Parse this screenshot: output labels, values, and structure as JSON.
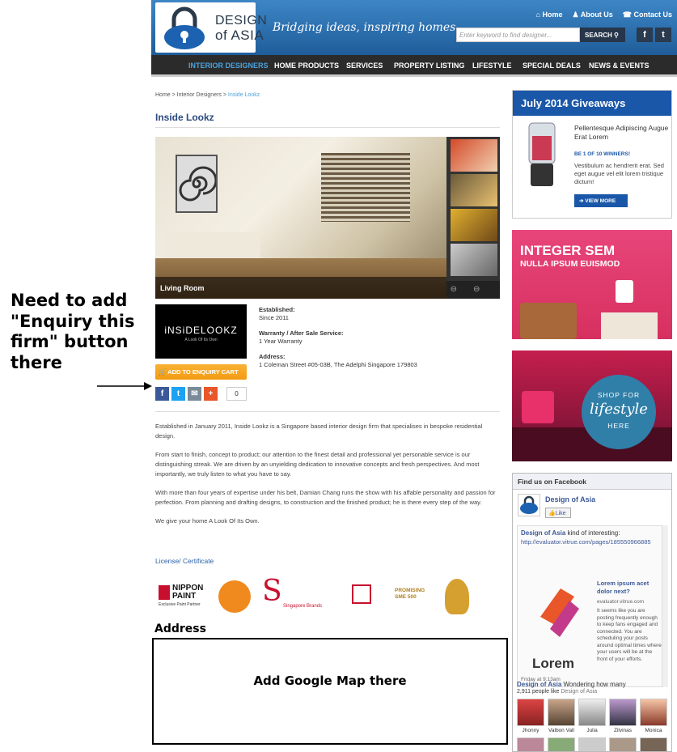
{
  "annotation": {
    "note": "Need to add \"Enquiry this firm\" button there",
    "address_heading": "Address",
    "map_note": "Add Google Map there"
  },
  "header": {
    "logo_line1": "DESIGN",
    "logo_line2": "of ASIA",
    "tagline": "Bridging ideas, inspiring homes.",
    "links": [
      "Home",
      "About Us",
      "Contact Us"
    ],
    "search_placeholder": "Enter keyword to find designer...",
    "search_button": "SEARCH",
    "social": [
      "f",
      "t"
    ]
  },
  "nav": {
    "items": [
      "INTERIOR DESIGNERS",
      "HOME PRODUCTS",
      "SERVICES",
      "PROPERTY LISTING",
      "LIFESTYLE",
      "SPECIAL DEALS",
      "NEWS & EVENTS"
    ],
    "active": "INTERIOR DESIGNERS"
  },
  "breadcrumb": {
    "items": [
      "Home",
      "Interior Designers",
      "Inside Lookz"
    ]
  },
  "firm": {
    "title": "Inside Lookz",
    "image_caption": "Living Room",
    "logo_text": "iNSiDELOOKZ",
    "logo_sub": "A Look Of Its Own",
    "established_label": "Established:",
    "established_value": "Since 2011",
    "warranty_label": "Warranty / After Sale Service:",
    "warranty_value": "1 Year Warranty",
    "address_label": "Address:",
    "address_value": "1 Coleman Street #05-03B, The Adelphi Singapore 179803",
    "cart_button": "ADD TO ENQUIRY CART",
    "share_count": "0",
    "description": [
      "Established in January 2011, Inside Lookz is a Singapore based interior design firm that specialises in bespoke residential design.",
      "From start to finish, concept to product; our attention to the finest detail and professional yet personable service is our distinguishing streak. We are driven by an unyielding dedication to innovative concepts and fresh perspectives. And most importantly, we truly listen to what you have to say.",
      "With more than four years of expertise under his belt, Damian Chang runs the show with his affable personality and passion for perfection. From planning and drafting designs, to construction and the finished product; he is there every step of the way.",
      "We give your home A Look Of Its Own."
    ],
    "license_link": "License/ Certificate",
    "certs": {
      "nippon": "NIPPON PAINT",
      "nippon_sub": "Exclusive Paint Partner",
      "sg_brands": "Singapore Brands",
      "promising": "PROMISING SME 500"
    }
  },
  "sidebar": {
    "giveaway_title": "July 2014 Giveaways",
    "giveaway_item": "Pellentesque Adipiscing Augue Erat Lorem",
    "giveaway_winners": "BE 1 OF 10 WINNERS!",
    "giveaway_desc": "Vestibulum ac hendrerit erat. Sed eget augue vel elit lorem tristique dictum!",
    "giveaway_button": "VIEW MORE",
    "ad1_title": "INTEGER SEM",
    "ad1_sub": "NULLA IPSUM EUISMOD",
    "ad2_line1": "SHOP FOR",
    "ad2_line2": "lifestyle",
    "ad2_line3": "HERE"
  },
  "facebook": {
    "header": "Find us on Facebook",
    "page_name": "Design of Asia",
    "like": "Like",
    "post_author": "Design of Asia",
    "post_action": "kind of interesting:",
    "post_link": "http://evaluator.vitrue.com/pages/185550966885",
    "card_title": "Lorem ipsum acet dolor next?",
    "card_domain": "evaluator.vitrue.com",
    "card_text": "It seems like you are posting frequently enough to keep fans engaged and connected. You are scheduling your posts around optimal times where your users will be at the front of your efforts.",
    "card_logo": "Lorem",
    "post_date": "Friday at 9:13am",
    "post2_author": "Design of Asia",
    "post2_action": "Wondering how many",
    "likes_count": "2,911 people like",
    "likes_page": "Design of Asia",
    "fans": [
      "Jhonny",
      "Valbon Vall",
      "Julia",
      "Zilvinas",
      "Monica"
    ]
  }
}
